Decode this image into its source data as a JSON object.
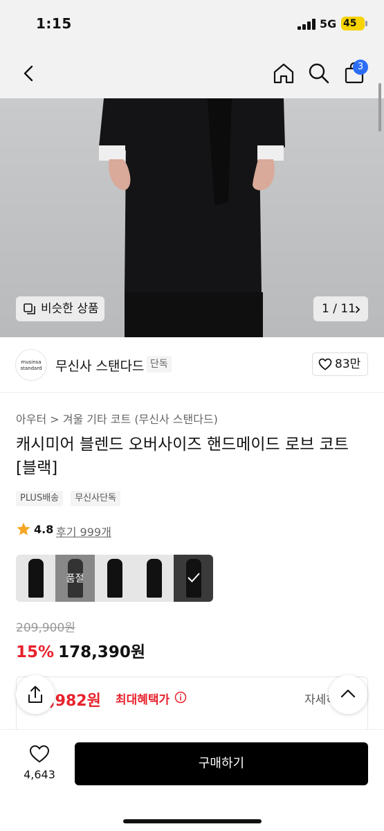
{
  "status": {
    "time": "1:15",
    "network": "5G",
    "battery": "45"
  },
  "nav": {
    "back_icon": "chevron-left-icon",
    "home_icon": "home-icon",
    "search_icon": "search-icon",
    "cart_icon": "shopping-bag-icon",
    "cart_count": "3"
  },
  "hero": {
    "similar_label": "비슷한 상품",
    "page_indicator": "1 / 11"
  },
  "brand": {
    "logo_line1": "musinsa",
    "logo_line2": "standard",
    "name": "무신사 스탠다드",
    "tag": "단독",
    "like_count": "83만"
  },
  "product": {
    "breadcrumb": "아우터 > 겨울 기타 코트 (무신사 스탠다드)",
    "title": "캐시미어 블렌드 오버사이즈 핸드메이드 로브 코트 [블랙]",
    "tags": [
      "PLUS배송",
      "무신사단독"
    ],
    "rating": "4.8",
    "review_text": "후기 999개",
    "color_options": [
      {
        "status": "available"
      },
      {
        "status": "soldout",
        "label": "품절"
      },
      {
        "status": "available"
      },
      {
        "status": "available"
      },
      {
        "status": "selected"
      }
    ],
    "original_price": "209,900원",
    "discount": "15%",
    "sale_price": "178,390원"
  },
  "benefit": {
    "price": "5,982원",
    "label": "최대혜택가",
    "detail": "자세히"
  },
  "bottom": {
    "wish_count": "4,643",
    "buy_label": "구매하기"
  },
  "colors": {
    "accent_red": "#e8212c",
    "badge_blue": "#2b6df5",
    "battery_yellow": "#f7d300"
  }
}
